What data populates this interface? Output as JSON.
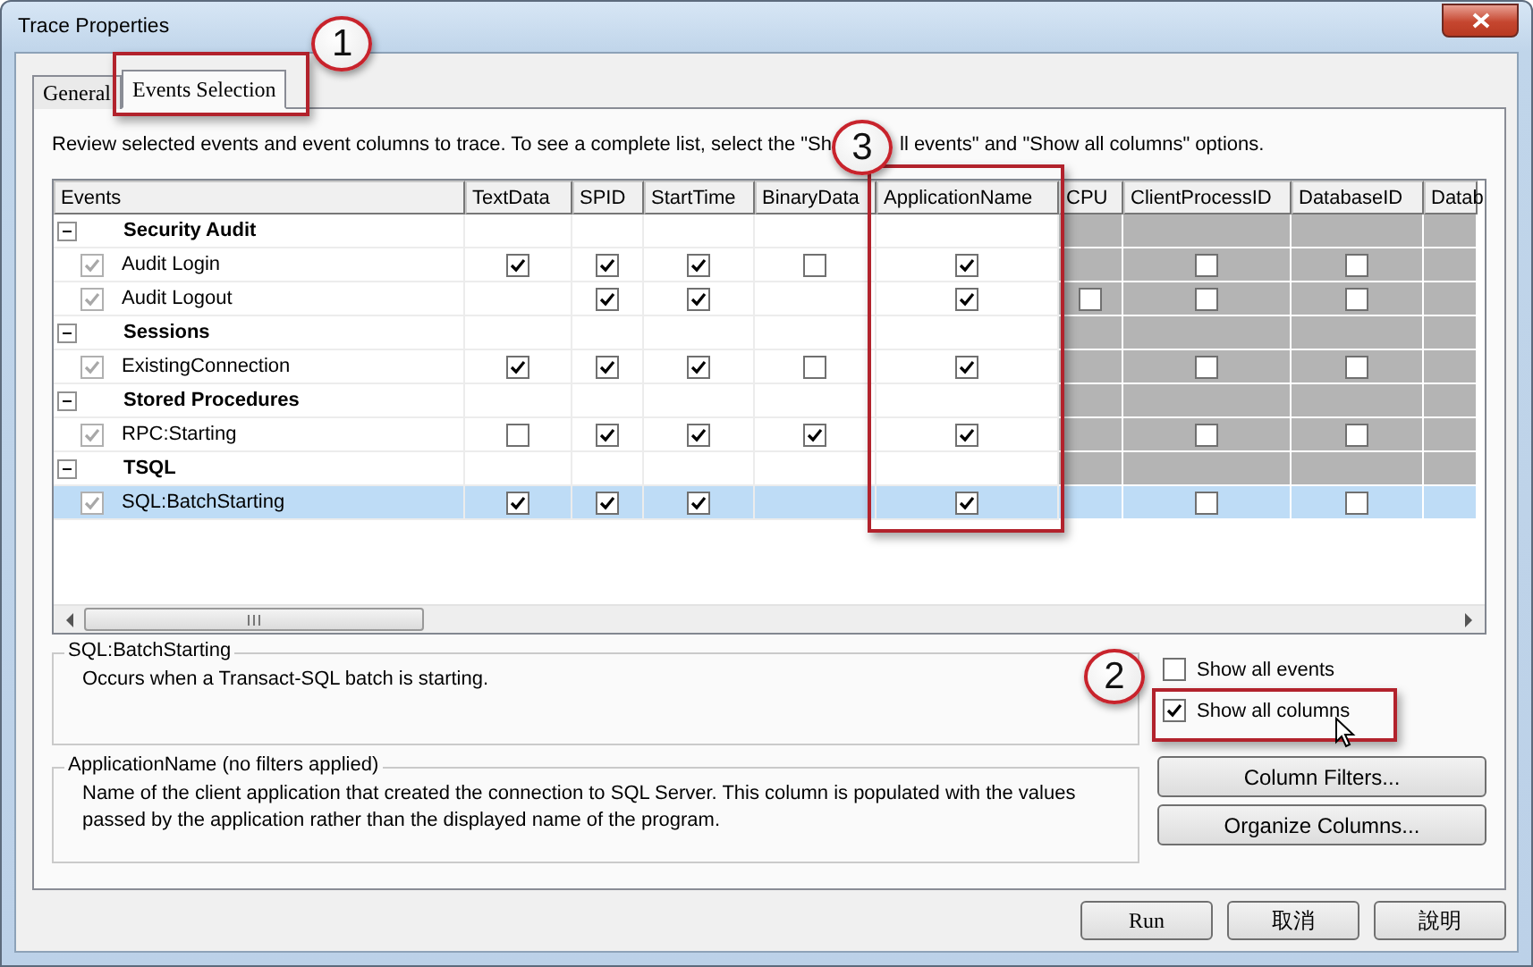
{
  "window": {
    "title": "Trace Properties"
  },
  "tabs": [
    {
      "label": "General",
      "selected": false
    },
    {
      "label": "Events Selection",
      "selected": true,
      "callout": "1"
    }
  ],
  "instructions": {
    "before": "Review selected events and event columns to trace. To see a complete list, select the \"Sh",
    "after": "ll events\" and \"Show all columns\" options."
  },
  "table": {
    "columns": [
      {
        "label": "Events",
        "shaded": false
      },
      {
        "label": "TextData",
        "shaded": false
      },
      {
        "label": "SPID",
        "shaded": false
      },
      {
        "label": "StartTime",
        "shaded": false
      },
      {
        "label": "BinaryData",
        "shaded": false
      },
      {
        "label": "ApplicationName",
        "shaded": false,
        "callout": "3"
      },
      {
        "label": "CPU",
        "shaded": true
      },
      {
        "label": "ClientProcessID",
        "shaded": true
      },
      {
        "label": "DatabaseID",
        "shaded": true
      },
      {
        "label": "Datab",
        "shaded": true
      }
    ],
    "rows": [
      {
        "kind": "category",
        "label": "Security Audit",
        "expanded": true,
        "selected": false
      },
      {
        "kind": "event",
        "label": "Audit Login",
        "checked": true,
        "selected": false,
        "cells": [
          true,
          true,
          true,
          false,
          true,
          null,
          false,
          false,
          null
        ]
      },
      {
        "kind": "event",
        "label": "Audit Logout",
        "checked": true,
        "selected": false,
        "cells": [
          null,
          true,
          true,
          null,
          true,
          false,
          false,
          false,
          null
        ]
      },
      {
        "kind": "category",
        "label": "Sessions",
        "expanded": true,
        "selected": false
      },
      {
        "kind": "event",
        "label": "ExistingConnection",
        "checked": true,
        "selected": false,
        "cells": [
          true,
          true,
          true,
          false,
          true,
          null,
          false,
          false,
          null
        ]
      },
      {
        "kind": "category",
        "label": "Stored Procedures",
        "expanded": true,
        "selected": false
      },
      {
        "kind": "event",
        "label": "RPC:Starting",
        "checked": true,
        "selected": false,
        "cells": [
          false,
          true,
          true,
          true,
          true,
          null,
          false,
          false,
          null
        ]
      },
      {
        "kind": "category",
        "label": "TSQL",
        "expanded": true,
        "selected": false
      },
      {
        "kind": "event",
        "label": "SQL:BatchStarting",
        "checked": true,
        "selected": true,
        "cells": [
          true,
          true,
          true,
          null,
          true,
          null,
          false,
          false,
          null
        ]
      }
    ]
  },
  "event_description": {
    "title": "SQL:BatchStarting",
    "text": "Occurs when a Transact-SQL batch is starting."
  },
  "column_description": {
    "title": "ApplicationName (no filters applied)",
    "text": "Name of the client application that created the connection to SQL Server. This column is populated with the values passed by the application rather than the displayed name of the program."
  },
  "options": [
    {
      "label": "Show all events",
      "checked": false
    },
    {
      "label": "Show all columns",
      "checked": true,
      "callout": "2"
    }
  ],
  "side_buttons": [
    "Column Filters...",
    "Organize Columns..."
  ],
  "buttons": [
    "Run",
    "取消",
    "說明"
  ]
}
